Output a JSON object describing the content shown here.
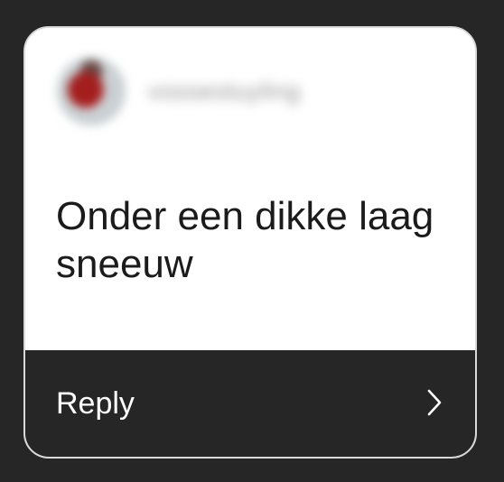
{
  "card": {
    "username": "vossestuyling",
    "message": "Onder een dikke laag sneeuw",
    "reply_label": "Reply"
  },
  "icons": {
    "avatar": "profile-avatar",
    "chevron": "chevron-right-icon"
  },
  "colors": {
    "background": "#262626",
    "card_top": "#ffffff",
    "card_bottom": "#262626",
    "border": "#d9d9d9"
  }
}
